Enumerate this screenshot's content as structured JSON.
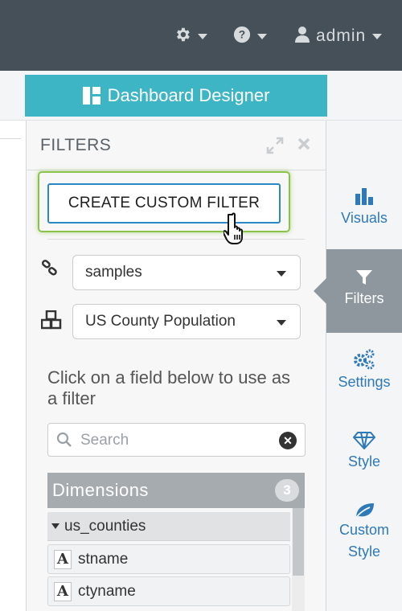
{
  "topnav": {
    "settings_icon": "gear-icon",
    "help_icon": "question-circle-icon",
    "user_icon": "user-icon",
    "user_label": "admin"
  },
  "designer_tab": {
    "label": "Dashboard Designer",
    "icon": "dashboard-icon"
  },
  "panel": {
    "title": "FILTERS",
    "create_filter_label": "CREATE CUSTOM FILTER",
    "connection_select": "samples",
    "dataset_select": "US County Population",
    "instruction": "Click on a field below to use as a filter",
    "search_placeholder": "Search",
    "dimensions": {
      "label": "Dimensions",
      "count": "3",
      "group": "us_counties",
      "fields": [
        "stname",
        "ctyname"
      ]
    }
  },
  "rightnav": {
    "items": [
      {
        "label": "Visuals",
        "icon": "bar-chart-icon"
      },
      {
        "label": "Filters",
        "icon": "filter-icon"
      },
      {
        "label": "Settings",
        "icon": "gears-icon"
      },
      {
        "label": "Style",
        "icon": "diamond-icon"
      },
      {
        "label": "Custom Style",
        "icon": "leaf-icon"
      }
    ],
    "active": "Filters"
  },
  "colors": {
    "topnav_bg": "#465058",
    "designer_tab": "#3db5c4",
    "highlight": "#8bc34a",
    "button_border": "#2d87c5",
    "nav_link": "#2e79b8",
    "active_nav": "#8e979e"
  }
}
